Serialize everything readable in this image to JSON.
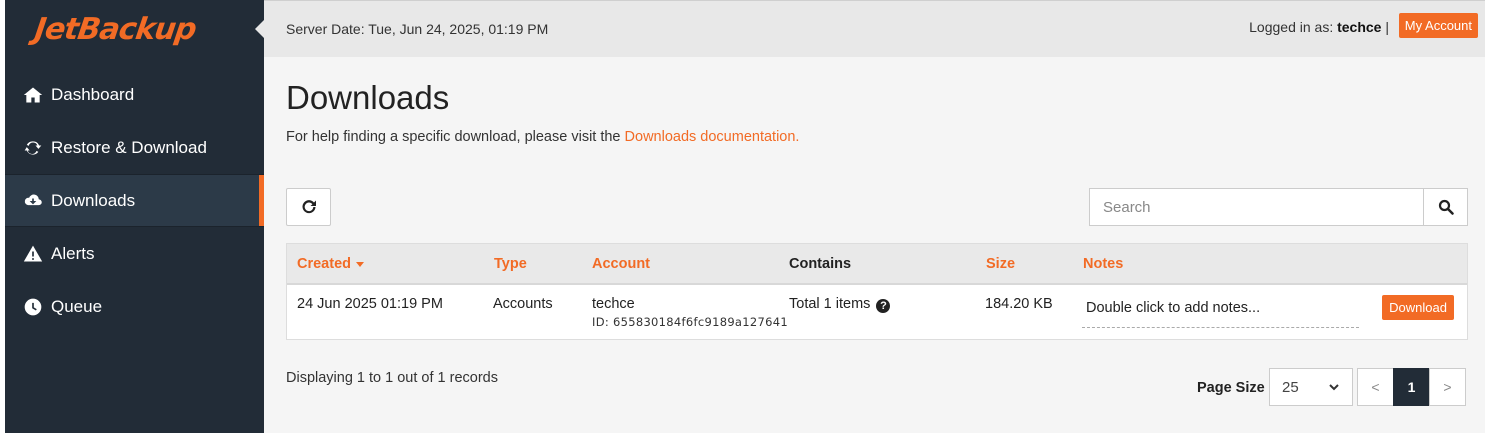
{
  "brand": {
    "logo_text": "JetBackup",
    "accent_color": "#f26b25",
    "sidebar_color": "#222c37"
  },
  "sidebar": {
    "items": [
      {
        "label": "Dashboard",
        "icon": "home-icon",
        "active": false
      },
      {
        "label": "Restore & Download",
        "icon": "sync-icon",
        "active": false
      },
      {
        "label": "Downloads",
        "icon": "cloud-download-icon",
        "active": true
      },
      {
        "label": "Alerts",
        "icon": "warning-icon",
        "active": false
      },
      {
        "label": "Queue",
        "icon": "clock-icon",
        "active": false
      }
    ]
  },
  "topbar": {
    "server_date": "Server Date: Tue, Jun 24, 2025, 01:19 PM",
    "logged_in_prefix": "Logged in as:",
    "username": "techce",
    "separator": "|",
    "my_account_label": "My Account"
  },
  "main": {
    "title": "Downloads",
    "help_text": "For help finding a specific download, please visit the",
    "help_link": "Downloads documentation.",
    "search_placeholder": "Search"
  },
  "table": {
    "columns": {
      "created": "Created",
      "type": "Type",
      "account": "Account",
      "contains": "Contains",
      "size": "Size",
      "notes": "Notes"
    },
    "sort_column": "created",
    "sort_direction": "desc",
    "rows": [
      {
        "created": "24 Jun 2025 01:19 PM",
        "type": "Accounts",
        "account": "techce",
        "account_id": "ID: 655830184f6fc9189a127641",
        "contains": "Total 1 items",
        "size": "184.20 KB",
        "notes_placeholder": "Double click to add notes...",
        "download_label": "Download"
      }
    ]
  },
  "footer": {
    "records_info": "Displaying 1 to 1 out of 1 records",
    "page_size_label": "Page Size",
    "page_size_value": "25",
    "prev_label": "<",
    "current_page": "1",
    "next_label": ">"
  }
}
